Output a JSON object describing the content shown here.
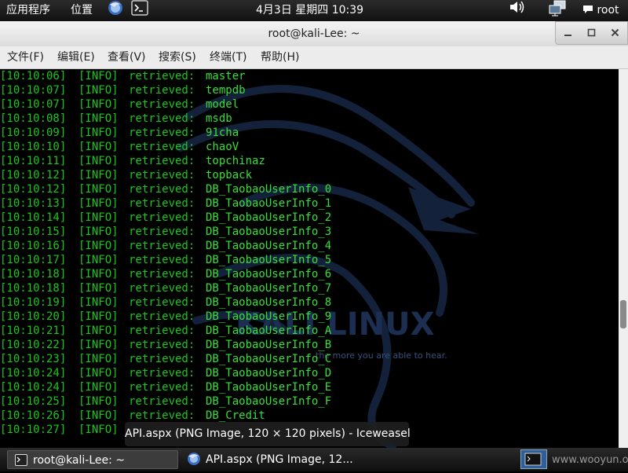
{
  "top_panel": {
    "applications_label": "应用程序",
    "places_label": "位置",
    "clock": "4月3日 星期四 10:39",
    "user": "root"
  },
  "window": {
    "title": "root@kali-Lee: ~",
    "menu": [
      "文件(F)",
      "编辑(E)",
      "查看(V)",
      "搜索(S)",
      "终端(T)",
      "帮助(H)"
    ]
  },
  "terminal": {
    "wallpaper_logo_text": "KALI LINUX",
    "wallpaper_tagline": "the more you are able to hear.",
    "lines": [
      {
        "time": "[10:10:06]",
        "level": "[INFO]",
        "message": "retrieved:",
        "value": "master"
      },
      {
        "time": "[10:10:07]",
        "level": "[INFO]",
        "message": "retrieved:",
        "value": "tempdb"
      },
      {
        "time": "[10:10:07]",
        "level": "[INFO]",
        "message": "retrieved:",
        "value": "model"
      },
      {
        "time": "[10:10:08]",
        "level": "[INFO]",
        "message": "retrieved:",
        "value": "msdb"
      },
      {
        "time": "[10:10:09]",
        "level": "[INFO]",
        "message": "retrieved:",
        "value": "91cha"
      },
      {
        "time": "[10:10:10]",
        "level": "[INFO]",
        "message": "retrieved:",
        "value": "chaoV"
      },
      {
        "time": "[10:10:11]",
        "level": "[INFO]",
        "message": "retrieved:",
        "value": "topchinaz"
      },
      {
        "time": "[10:10:12]",
        "level": "[INFO]",
        "message": "retrieved:",
        "value": "topback"
      },
      {
        "time": "[10:10:12]",
        "level": "[INFO]",
        "message": "retrieved:",
        "value": "DB_TaobaoUserInfo_0"
      },
      {
        "time": "[10:10:13]",
        "level": "[INFO]",
        "message": "retrieved:",
        "value": "DB_TaobaoUserInfo_1"
      },
      {
        "time": "[10:10:14]",
        "level": "[INFO]",
        "message": "retrieved:",
        "value": "DB_TaobaoUserInfo_2"
      },
      {
        "time": "[10:10:15]",
        "level": "[INFO]",
        "message": "retrieved:",
        "value": "DB_TaobaoUserInfo_3"
      },
      {
        "time": "[10:10:16]",
        "level": "[INFO]",
        "message": "retrieved:",
        "value": "DB_TaobaoUserInfo_4"
      },
      {
        "time": "[10:10:17]",
        "level": "[INFO]",
        "message": "retrieved:",
        "value": "DB_TaobaoUserInfo_5"
      },
      {
        "time": "[10:10:18]",
        "level": "[INFO]",
        "message": "retrieved:",
        "value": "DB_TaobaoUserInfo_6"
      },
      {
        "time": "[10:10:18]",
        "level": "[INFO]",
        "message": "retrieved:",
        "value": "DB_TaobaoUserInfo_7"
      },
      {
        "time": "[10:10:19]",
        "level": "[INFO]",
        "message": "retrieved:",
        "value": "DB_TaobaoUserInfo_8"
      },
      {
        "time": "[10:10:20]",
        "level": "[INFO]",
        "message": "retrieved:",
        "value": "DB_TaobaoUserInfo_9"
      },
      {
        "time": "[10:10:21]",
        "level": "[INFO]",
        "message": "retrieved:",
        "value": "DB_TaobaoUserInfo_A"
      },
      {
        "time": "[10:10:22]",
        "level": "[INFO]",
        "message": "retrieved:",
        "value": "DB_TaobaoUserInfo_B"
      },
      {
        "time": "[10:10:23]",
        "level": "[INFO]",
        "message": "retrieved:",
        "value": "DB_TaobaoUserInfo_C"
      },
      {
        "time": "[10:10:24]",
        "level": "[INFO]",
        "message": "retrieved:",
        "value": "DB_TaobaoUserInfo_D"
      },
      {
        "time": "[10:10:24]",
        "level": "[INFO]",
        "message": "retrieved:",
        "value": "DB_TaobaoUserInfo_E"
      },
      {
        "time": "[10:10:25]",
        "level": "[INFO]",
        "message": "retrieved:",
        "value": "DB_TaobaoUserInfo_F"
      },
      {
        "time": "[10:10:26]",
        "level": "[INFO]",
        "message": "retrieved:",
        "value": "DB_Credit"
      },
      {
        "time": "[10:10:27]",
        "level": "[INFO]",
        "message": "",
        "value": ""
      }
    ]
  },
  "tooltip": "API.aspx (PNG Image, 120 × 120 pixels) - Iceweasel",
  "taskbar": {
    "tasks": [
      "root@kali-Lee: ~",
      "API.aspx (PNG Image, 12..."
    ],
    "watermark": "www.wooyun.org"
  },
  "colors": {
    "terminal_text": "#18c818",
    "terminal_bg": "#000000",
    "panel_bg": "#1a1a1a"
  }
}
